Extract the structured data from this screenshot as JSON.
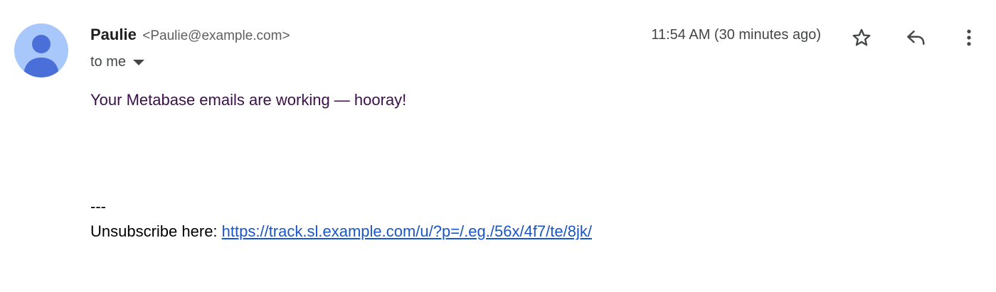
{
  "sender": {
    "name": "Paulie",
    "email": "<Paulie@example.com>",
    "avatar_icon": "person-icon",
    "avatar_bg": "#a8c7fa",
    "avatar_fg": "#4a6fd8"
  },
  "recipient": {
    "label": "to me",
    "dropdown_icon": "caret-down-icon"
  },
  "timestamp": "11:54 AM (30 minutes ago)",
  "actions": {
    "star_icon": "star-icon",
    "reply_icon": "reply-icon",
    "more_icon": "more-vert-icon"
  },
  "body": {
    "message": "Your Metabase emails are working — hooray!",
    "message_color": "#3c0f4a",
    "signature_separator": "---",
    "unsubscribe_label": "Unsubscribe here: ",
    "unsubscribe_link": "https://track.sl.example.com/u/?p=/.eg./56x/4f7/te/8jk/",
    "link_color": "#1a55c9"
  }
}
